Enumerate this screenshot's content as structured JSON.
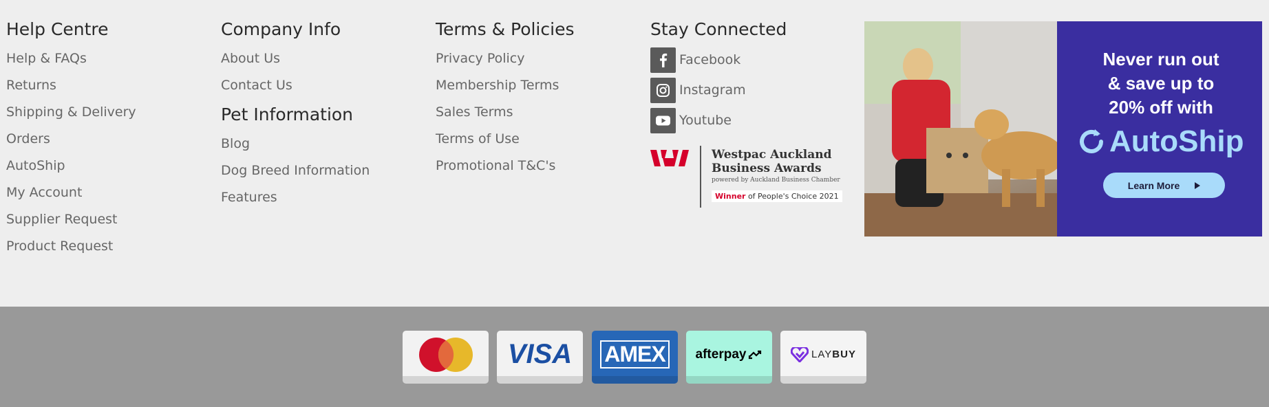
{
  "help": {
    "title": "Help Centre",
    "links": [
      "Help & FAQs",
      "Returns",
      "Shipping & Delivery",
      "Orders",
      "AutoShip",
      "My Account",
      "Supplier Request",
      "Product Request"
    ]
  },
  "company": {
    "title": "Company Info",
    "links": [
      "About Us",
      "Contact Us"
    ]
  },
  "pet": {
    "title": "Pet Information",
    "links": [
      "Blog",
      "Dog Breed Information",
      "Features"
    ]
  },
  "terms": {
    "title": "Terms & Policies",
    "links": [
      "Privacy Policy",
      "Membership Terms",
      "Sales Terms",
      "Terms of Use",
      "Promotional T&C's"
    ]
  },
  "social": {
    "title": "Stay Connected",
    "items": [
      {
        "label": "Facebook",
        "icon": "facebook-icon"
      },
      {
        "label": "Instagram",
        "icon": "instagram-icon"
      },
      {
        "label": "Youtube",
        "icon": "youtube-icon"
      }
    ]
  },
  "award": {
    "title_line1": "Westpac Auckland",
    "title_line2": "Business Awards",
    "subtitle": "powered by Auckland Business Chamber",
    "winner": "Winner",
    "badge_rest": "of People's Choice 2021",
    "colors": {
      "westpac_red": "#d5002b"
    }
  },
  "banner": {
    "line1": "Never run out",
    "line2": "& save up to",
    "line3": "20% off",
    "line3_suffix": " with",
    "brand": "AutoShip",
    "button": "Learn More",
    "colors": {
      "bg": "#3a2ea0",
      "accent": "#a9dbfa"
    }
  },
  "payments": {
    "visa": "VISA",
    "amex": "AMEX",
    "afterpay": "afterpay",
    "laybuy_lay": "LAY",
    "laybuy_buy": "BUY",
    "icons": [
      "mastercard-logo",
      "visa-logo",
      "amex-logo",
      "afterpay-logo",
      "laybuy-logo"
    ]
  }
}
